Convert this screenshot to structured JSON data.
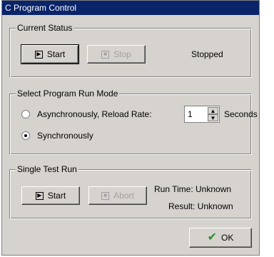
{
  "window": {
    "title": "C Program Control"
  },
  "current_status": {
    "legend": "Current Status",
    "start_label": "Start",
    "stop_label": "Stop",
    "status_text": "Stopped"
  },
  "run_mode": {
    "legend": "Select Program Run Mode",
    "async_label": "Asynchronously, Reload Rate:",
    "reload_value": "1",
    "seconds_label": "Seconds",
    "sync_label": "Synchronously",
    "selected": "synchronously"
  },
  "single_test": {
    "legend": "Single Test Run",
    "start_label": "Start",
    "abort_label": "Abort",
    "run_time": "Run Time: Unknown",
    "result": "Result: Unknown"
  },
  "ok_label": "OK",
  "colors": {
    "titlebar": "#0a246a",
    "dialog_bg": "#d6d3ce",
    "ok_check": "#2e8b2e"
  },
  "icons": {
    "play": "play-icon",
    "stop": "stop-icon",
    "ok": "checkmark-icon"
  }
}
